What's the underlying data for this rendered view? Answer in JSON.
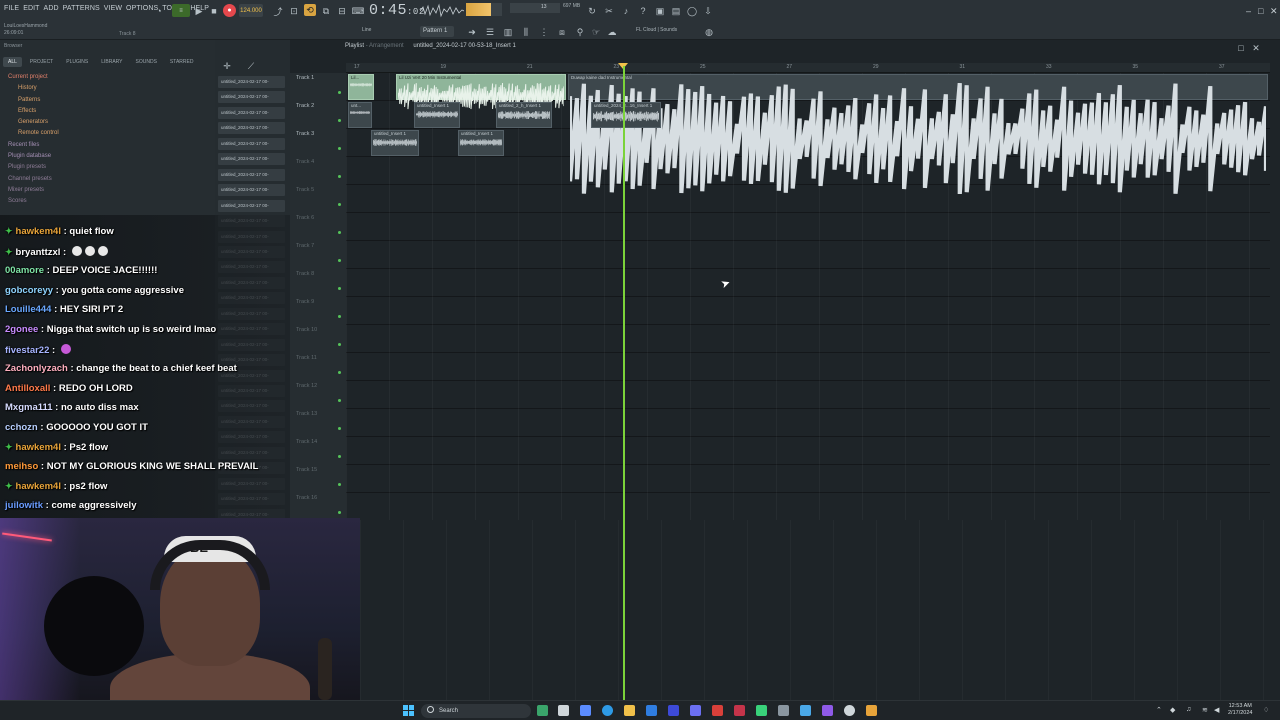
{
  "menu": [
    "FILE",
    "EDIT",
    "ADD",
    "PATTERNS",
    "VIEW",
    "OPTIONS",
    "TOOLS",
    "HELP"
  ],
  "project": {
    "user": "LouiLoesHammond",
    "time": "26:09:01",
    "track_hint": "Track 8"
  },
  "transport": {
    "tempo": "124.000",
    "time_main": "0:45",
    "time_sub": "02",
    "mem": "697 MB",
    "mem2": "13",
    "pattern": "Pattern 1",
    "cloud": "FL Cloud | Sounds",
    "line_mode": "Line"
  },
  "browser": {
    "title": "Browser",
    "tabs": [
      "ALL",
      "PROJECT",
      "PLUGINS",
      "LIBRARY",
      "SOUNDS",
      "STARRED"
    ],
    "items": [
      {
        "label": "Current project",
        "kind": "root"
      },
      {
        "label": "History",
        "kind": "sub"
      },
      {
        "label": "Patterns",
        "kind": "sub"
      },
      {
        "label": "Effects",
        "kind": "sub"
      },
      {
        "label": "Generators",
        "kind": "sub"
      },
      {
        "label": "Remote control",
        "kind": "sub"
      },
      {
        "label": "Recent files",
        "kind": "other"
      },
      {
        "label": "Plugin database",
        "kind": "other"
      },
      {
        "label": "Plugin presets",
        "kind": "faded"
      },
      {
        "label": "Channel presets",
        "kind": "faded"
      },
      {
        "label": "Mixer presets",
        "kind": "faded"
      },
      {
        "label": "Scores",
        "kind": "faded"
      }
    ]
  },
  "chat": [
    {
      "user": "hawkem4l",
      "color": "#e8a43a",
      "badge": true,
      "text": "quiet flow",
      "emotes": 0
    },
    {
      "user": "bryanttzxl",
      "color": "#ffffff",
      "badge": true,
      "text": "",
      "emotes": 3
    },
    {
      "user": "00amore",
      "color": "#7fe4a6",
      "badge": false,
      "text": "DEEP VOICE JACE!!!!!!",
      "emotes": 0
    },
    {
      "user": "gobcoreyy",
      "color": "#8fd4ff",
      "badge": false,
      "text": "you gotta come aggressive",
      "emotes": 0
    },
    {
      "user": "Louille444",
      "color": "#6aa8ff",
      "badge": false,
      "text": "HEY SIRI PT 2",
      "emotes": 0
    },
    {
      "user": "2gonee",
      "color": "#c98cff",
      "badge": false,
      "text": "Nigga that switch up is so weird lmao",
      "emotes": 0
    },
    {
      "user": "fivestar22",
      "color": "#a7b4ff",
      "badge": false,
      "text": "",
      "emotes": 1
    },
    {
      "user": "Zachonlyzach",
      "color": "#ffb0c0",
      "badge": false,
      "text": "change the beat to a chief keef beat",
      "emotes": 0
    },
    {
      "user": "Antilloxall",
      "color": "#ff7a4a",
      "badge": false,
      "text": "REDO OH LORD",
      "emotes": 0
    },
    {
      "user": "Mxgma111",
      "color": "#d6dcff",
      "badge": false,
      "text": "no auto diss max",
      "emotes": 0
    },
    {
      "user": "cchozn",
      "color": "#b8d0ff",
      "badge": false,
      "text": "GOOOOO YOU GOT IT",
      "emotes": 0
    },
    {
      "user": "hawkem4l",
      "color": "#e8a43a",
      "badge": true,
      "text": "Ps2 flow",
      "emotes": 0
    },
    {
      "user": "meihso",
      "color": "#ff9a3a",
      "badge": false,
      "text": "NOT MY GLORIOUS KING WE SHALL PREVAIL",
      "emotes": 0
    },
    {
      "user": "hawkem4l",
      "color": "#e8a43a",
      "badge": true,
      "text": "ps2 flow",
      "emotes": 0
    },
    {
      "user": "juilowitk",
      "color": "#6a9cff",
      "badge": false,
      "text": "come aggressively",
      "emotes": 0
    }
  ],
  "channels": [
    "untitled_2024-02-17 00-",
    "untitled_2024-02-17 00-",
    "untitled_2024-02-17 00-",
    "untitled_2024-02-17 00-",
    "untitled_2024-02-17 00-",
    "untitled_2024-02-17 00-",
    "untitled_2024-02-17 00-",
    "untitled_2024-02-17 00-",
    "untitled_2024-02-17 00-",
    "untitled_2024-02-17 00-",
    "untitled_2024-02-17 00-",
    "untitled_2024-02-17 00-",
    "untitled_2024-02-17 00-",
    "untitled_2024-02-17 00-",
    "untitled_2024-02-17 00-",
    "untitled_2024-02-17 00-",
    "untitled_2024-02-17 00-",
    "untitled_2024-02-17 00-",
    "untitled_2024-02-17 00-",
    "untitled_2024-02-17 00-",
    "untitled_2024-02-17 00-",
    "untitled_2024-02-17 00-",
    "untitled_2024-02-17 00-",
    "untitled_2024-02-17 00-",
    "untitled_2024-02-17 00-",
    "untitled_2024-02-17 00-",
    "untitled_2024-02-17 00-",
    "untitled_2024-02-17 00-",
    "untitled_2024-02-17 00-",
    "untitled_2024-02-17 00-",
    "untitled_2024-02-17 00-"
  ],
  "playlist": {
    "title": "Playlist",
    "subtitle": "Arrangement",
    "pattern_path": "untitled_2024-02-17 00-53-18_Insert 1",
    "ruler": [
      "17",
      "19",
      "21",
      "23",
      "25",
      "27",
      "29",
      "31",
      "33",
      "35",
      "37"
    ],
    "tracks": [
      "Track 1",
      "Track 2",
      "Track 3",
      "Track 4",
      "Track 5",
      "Track 6",
      "Track 7",
      "Track 8",
      "Track 9",
      "Track 10",
      "Track 11",
      "Track 12",
      "Track 13",
      "Track 14",
      "Track 15",
      "Track 16"
    ],
    "clips": [
      {
        "track": 0,
        "label": "Lil...",
        "kind": "green"
      },
      {
        "track": 0,
        "label": "Lil Uzi Vert 20 Min Instrumental",
        "kind": "green"
      },
      {
        "track": 0,
        "label": "Duwap kaine dad Instrumental",
        "kind": "grey"
      },
      {
        "track": 1,
        "label": "unt...",
        "kind": "grey"
      },
      {
        "track": 1,
        "label": "untitled_Insert 1",
        "kind": "grey"
      },
      {
        "track": 1,
        "label": "untitled_2_h_Insert 1",
        "kind": "grey"
      },
      {
        "track": 1,
        "label": "untitled_2024_2...16_Insert 1",
        "kind": "grey"
      },
      {
        "track": 2,
        "label": "untitled_Insert 1",
        "kind": "grey"
      },
      {
        "track": 2,
        "label": "untitled_Insert 1",
        "kind": "grey"
      }
    ]
  },
  "taskbar": {
    "search": "Search",
    "time": "12:53 AM",
    "date": "2/17/2024"
  },
  "webcam": {
    "cap_text": "BE"
  },
  "colors": {
    "playhead": "#7bd33a",
    "accent": "#f2c24a",
    "record": "#e5484d"
  }
}
